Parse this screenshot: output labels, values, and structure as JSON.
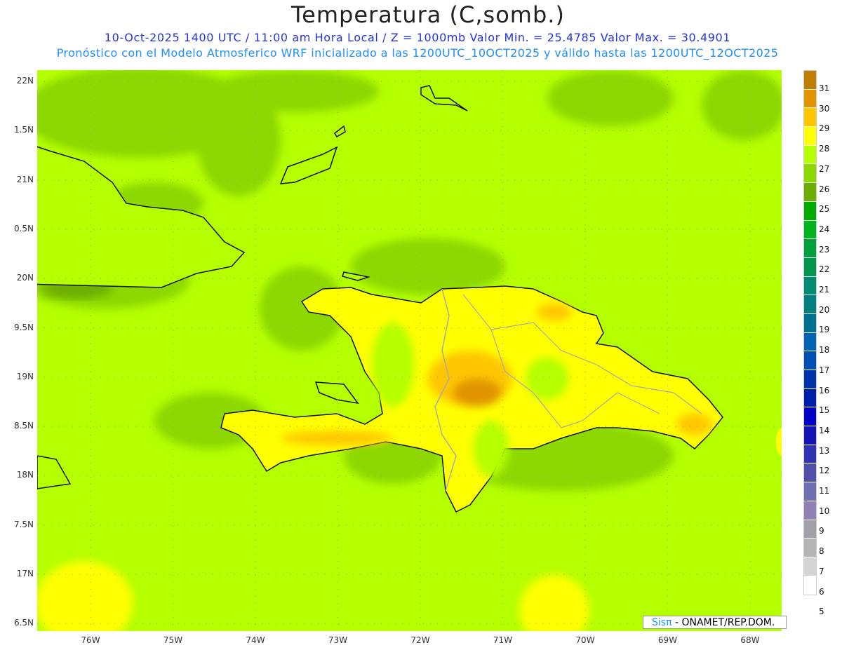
{
  "header": {
    "title": "Temperatura (C,somb.)",
    "line1": "10-Oct-2025 1400 UTC / 11:00 am Hora Local / Z = 1000mb  Valor Min. = 25.4785  Valor Max. = 30.4901",
    "line2": "Pronóstico con el Modelo Atmosferico WRF inicializado a las 1200UTC_10OCT2025 y válido hasta las  1200UTC_12OCT2025"
  },
  "y_axis": [
    "22N",
    "1.5N",
    "21N",
    "0.5N",
    "20N",
    "9.5N",
    "19N",
    "8.5N",
    "18N",
    "7.5N",
    "17N",
    "6.5N"
  ],
  "x_axis": [
    "76W",
    "75W",
    "74W",
    "73W",
    "72W",
    "71W",
    "70W",
    "69W",
    "68W"
  ],
  "colorbar": {
    "labels": [
      "31",
      "30",
      "29",
      "28",
      "27",
      "26",
      "25",
      "24",
      "23",
      "22",
      "21",
      "20",
      "19",
      "18",
      "17",
      "16",
      "15",
      "14",
      "13",
      "12",
      "11",
      "10",
      "9",
      "8",
      "7",
      "6",
      "5"
    ],
    "colors": [
      "#c07e00",
      "#e09400",
      "#ffc600",
      "#ffff00",
      "#b4ff00",
      "#8cd800",
      "#6cae00",
      "#00aa00",
      "#00b41e",
      "#00a03c",
      "#009650",
      "#008c6e",
      "#008080",
      "#007090",
      "#0064b4",
      "#0050b4",
      "#0032aa",
      "#001eaa",
      "#0000c8",
      "#1414b4",
      "#3232b4",
      "#5050aa",
      "#7070b0",
      "#9080b4",
      "#a0a0a8",
      "#b4b4b4",
      "#d4d4d4",
      "#ffffff"
    ]
  },
  "logo": {
    "brand": "Sisπ",
    "text": " - ONAMET/REP.DOM."
  },
  "colors": {
    "sea": "#b4ff00",
    "cool": "#8cd800",
    "cooler": "#6cae00",
    "land": "#ffff00",
    "warm": "#ffc600",
    "hot": "#e09400"
  }
}
